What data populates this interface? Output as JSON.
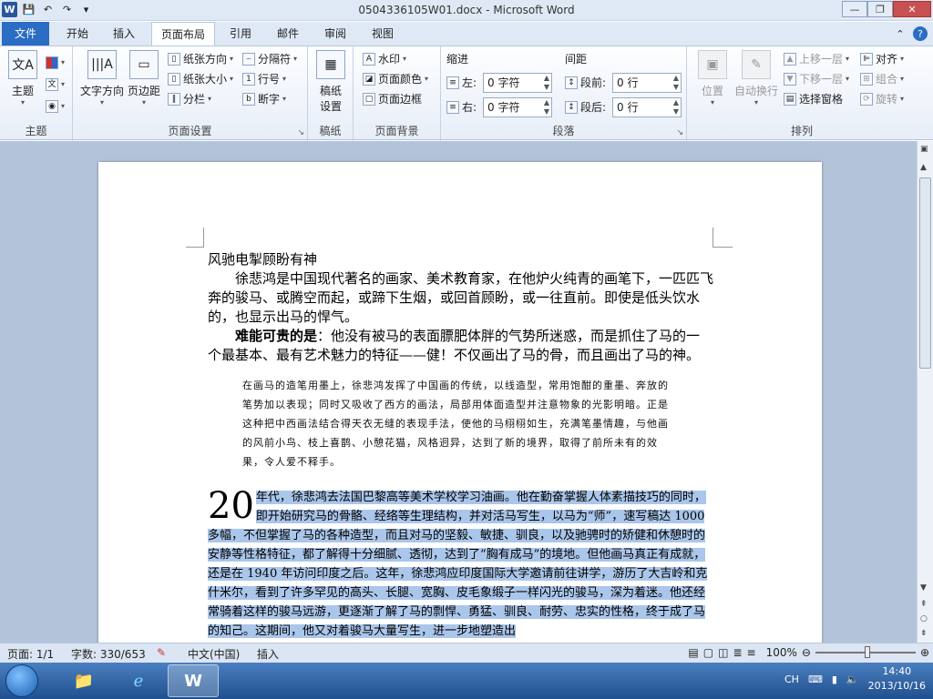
{
  "titlebar": {
    "title": "0504336105W01.docx - Microsoft Word"
  },
  "tabs": [
    "文件",
    "开始",
    "插入",
    "页面布局",
    "引用",
    "邮件",
    "审阅",
    "视图"
  ],
  "ribbon": {
    "theme": {
      "label": "主题",
      "btn_theme": "主题"
    },
    "page_setup": {
      "label": "页面设置",
      "text_dir": "文字方向",
      "margins": "页边距",
      "orientation": "纸张方向",
      "size": "纸张大小",
      "columns": "分栏",
      "breaks": "分隔符",
      "line_num": "行号",
      "hyphen": "断字"
    },
    "draft": {
      "label": "稿纸",
      "btn": "稿纸\n设置"
    },
    "background": {
      "label": "页面背景",
      "watermark": "水印",
      "color": "页面颜色",
      "border": "页面边框"
    },
    "paragraph": {
      "label": "段落",
      "indent": "缩进",
      "spacing": "间距",
      "left": "左:",
      "right": "右:",
      "before": "段前:",
      "after": "段后:",
      "left_val": "0 字符",
      "right_val": "0 字符",
      "before_val": "0 行",
      "after_val": "0 行"
    },
    "arrange": {
      "label": "排列",
      "position": "位置",
      "wrap": "自动换行",
      "forward": "上移一层",
      "backward": "下移一层",
      "pane": "选择窗格",
      "align": "对齐",
      "group": "组合",
      "rotate": "旋转"
    }
  },
  "doc": {
    "heading": "风驰电掣顾盼有神",
    "p1": "徐悲鸿是中国现代著名的画家、美术教育家，在他炉火纯青的画笔下，一匹匹飞奔的骏马、或腾空而起，或蹄下生烟，或回首顾盼，或一往直前。即使是低头饮水的，也显示出马的悍气。",
    "p2_bold": "难能可贵的是",
    "p2_rest": "：他没有被马的表面膘肥体胖的气势所迷惑，而是抓住了马的一个最基本、最有艺术魅力的特征——健！不仅画出了马的骨，而且画出了马的神。",
    "quote": "在画马的造笔用墨上，徐悲鸿发挥了中国画的传统，以线造型，常用饱酣的重墨、奔放的笔势加以表现；同时又吸收了西方的画法，局部用体面造型并注意物象的光影明暗。正是这种把中西画法结合得天衣无缝的表现手法，使他的马栩栩如生，充满笔墨情趣，与他画的风前小鸟、枝上喜鹊、小憩花猫，风格迥异，达到了新的境界，取得了前所未有的效果，令人爱不释手。",
    "dropcap": "20",
    "drop_text": "年代，徐悲鸿去法国巴黎高等美术学校学习油画。他在勤奋掌握人体素描技巧的同时，即开始研究马的骨骼、经络等生理结构，并对活马写生，以马为“师”，速写稿达 1000 多幅，不但掌握了马的各种造型，而且对马的坚毅、敏捷、驯良，以及驰骋时的矫健和休憩时的安静等性格特征，都了解得十分细腻、透彻，达到了“胸有成马”的境地。但他画马真正有成就，还是在 1940 年访问印度之后。这年，徐悲鸿应印度国际大学邀请前往讲学，游历了大吉岭和克什米尔，看到了许多罕见的高头、长腿、宽胸、皮毛象缎子一样闪光的骏马，深为着迷。他还经常骑着这样的骏马远游，更逐渐了解了马的剽悍、勇猛、驯良、耐劳、忠实的性格，终于成了马的知己。这期间，他又对着骏马大量写生，进一步地塑造出"
  },
  "status": {
    "page": "页面: 1/1",
    "words": "字数: 330/653",
    "lang": "中文(中国)",
    "mode": "插入",
    "zoom": "100%"
  },
  "taskbar": {
    "lang": "CH",
    "time": "14:40",
    "date": "2013/10/16"
  }
}
